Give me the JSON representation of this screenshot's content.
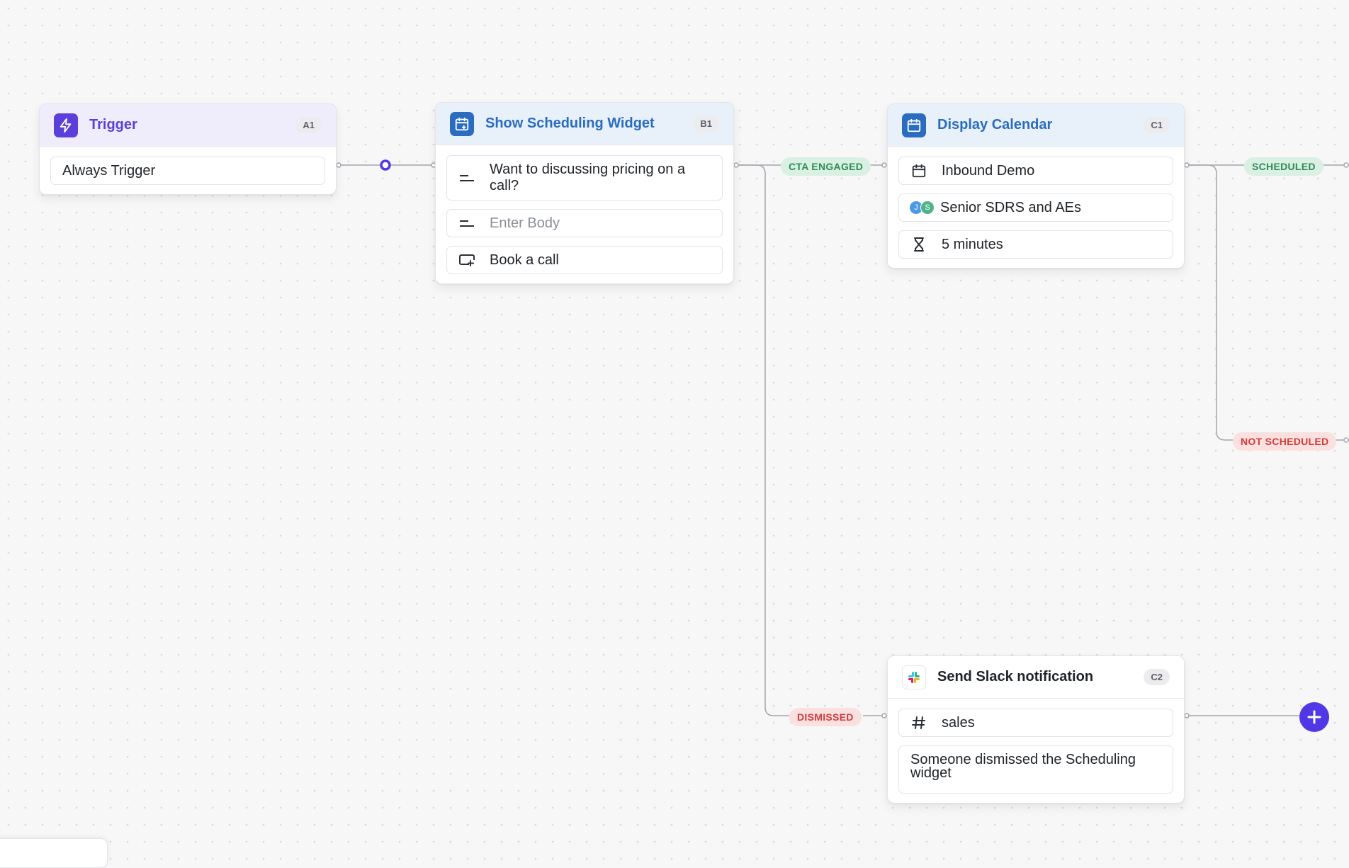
{
  "nodes": {
    "trigger": {
      "title": "Trigger",
      "badge": "A1",
      "fields": [
        "Always Trigger"
      ]
    },
    "scheduling_widget": {
      "title": "Show Scheduling Widget",
      "badge": "B1",
      "heading_field": "Want to discussing pricing on a call?",
      "body_placeholder": "Enter Body",
      "button_field": "Book a call"
    },
    "display_calendar": {
      "title": "Display Calendar",
      "badge": "C1",
      "calendar": "Inbound Demo",
      "team": "Senior SDRS and AEs",
      "avatars": [
        "J",
        "S"
      ],
      "duration": "5 minutes"
    },
    "slack": {
      "title": "Send Slack notification",
      "badge": "C2",
      "channel": "sales",
      "message": "Someone dismissed the Scheduling widget"
    }
  },
  "edges": {
    "cta_engaged": "CTA ENGAGED",
    "dismissed": "DISMISSED",
    "scheduled": "SCHEDULED",
    "not_scheduled": "NOT SCHEDULED"
  },
  "colors": {
    "accent": "#5038e6",
    "trigger_purple": "#5b3fd9",
    "action_blue": "#2a6cc0",
    "success_green": "#2e8b57",
    "danger_red": "#d23b3b"
  },
  "icons": {
    "trigger": "lightning-bolt-icon",
    "scheduling_widget": "calendar-plus-icon",
    "display_calendar": "calendar-icon",
    "slack": "slack-icon",
    "heading": "text-lines-icon",
    "body": "text-lines-icon",
    "button": "button-cursor-icon",
    "duration": "hourglass-icon",
    "channel": "hash-icon",
    "add": "plus-icon"
  }
}
